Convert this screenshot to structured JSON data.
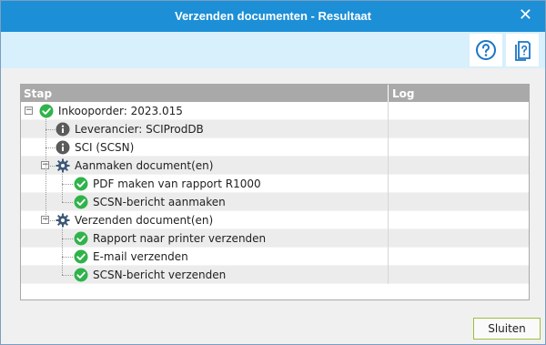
{
  "window": {
    "title": "Verzenden documenten - Resultaat",
    "close_glyph": "✕",
    "accent_color": "#1c8fd6",
    "banner_color": "#d8effc"
  },
  "toolbar": {
    "help_icon": "help-circle-icon",
    "report_icon": "document-help-icon"
  },
  "grid": {
    "columns": {
      "stap": "Stap",
      "log": "Log"
    },
    "rows": [
      {
        "label": "Inkooporder: 2023.015",
        "icon": "check-icon",
        "level": 0,
        "expander": "−"
      },
      {
        "label": "Leverancier: SCIProdDB",
        "icon": "info-icon",
        "level": 1
      },
      {
        "label": "SCI (SCSN)",
        "icon": "info-icon",
        "level": 1
      },
      {
        "label": "Aanmaken document(en)",
        "icon": "gear-icon",
        "level": 1,
        "expander": "−"
      },
      {
        "label": "PDF maken van rapport R1000",
        "icon": "check-icon",
        "level": 2
      },
      {
        "label": "SCSN-bericht aanmaken",
        "icon": "check-icon",
        "level": 2
      },
      {
        "label": "Verzenden document(en)",
        "icon": "gear-icon",
        "level": 1,
        "expander": "−"
      },
      {
        "label": "Rapport naar printer verzenden",
        "icon": "check-icon",
        "level": 2
      },
      {
        "label": "E-mail verzenden",
        "icon": "check-icon",
        "level": 2
      },
      {
        "label": "SCSN-bericht verzenden",
        "icon": "check-icon",
        "level": 2
      }
    ]
  },
  "footer": {
    "close_label": "Sluiten"
  }
}
